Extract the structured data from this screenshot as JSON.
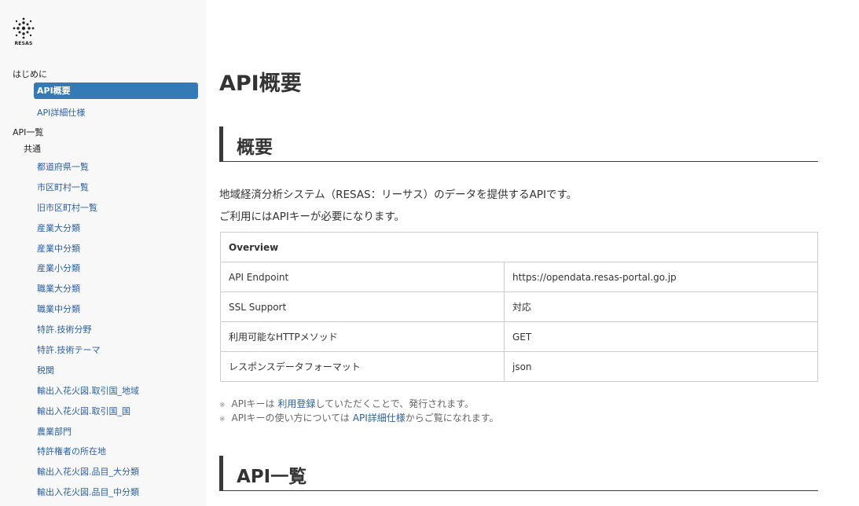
{
  "logo": {
    "text": "RESAS"
  },
  "sidebar": {
    "intro_label": "はじめに",
    "intro_items": [
      {
        "label": "API概要",
        "active": true
      },
      {
        "label": "API詳細仕様",
        "active": false
      }
    ],
    "api_list_label": "API一覧",
    "common_label": "共通",
    "common_items": [
      "都道府県一覧",
      "市区町村一覧",
      "旧市区町村一覧",
      "産業大分類",
      "産業中分類",
      "産業小分類",
      "職業大分類",
      "職業中分類",
      "特許.技術分野",
      "特許.技術テーマ",
      "税関",
      "輸出入花火図.取引国_地域",
      "輸出入花火図.取引国_国",
      "農業部門",
      "特許権者の所在地",
      "輸出入花火図.品目_大分類",
      "輸出入花火図.品目_中分類"
    ]
  },
  "main": {
    "title": "API概要",
    "section1": {
      "heading": "概要",
      "line1": "地域経済分析システム（RESAS：リーサス）のデータを提供するAPIです。",
      "line2": "ご利用にはAPIキーが必要になります。"
    },
    "table": {
      "header": "Overview",
      "rows": [
        {
          "name": "API Endpoint",
          "value": "https://opendata.resas-portal.go.jp"
        },
        {
          "name": "SSL Support",
          "value": "対応"
        },
        {
          "name": "利用可能なHTTPメソッド",
          "value": "GET"
        },
        {
          "name": "レスポンスデータフォーマット",
          "value": "json"
        }
      ]
    },
    "notes": [
      {
        "mark": "※",
        "before": "APIキーは ",
        "link": "利用登録",
        "after": "していただくことで、発行されます。"
      },
      {
        "mark": "※",
        "before": "APIキーの使い方については ",
        "link": "API詳細仕様",
        "after": "からご覧になれます。"
      }
    ],
    "section2": {
      "heading": "API一覧"
    }
  }
}
